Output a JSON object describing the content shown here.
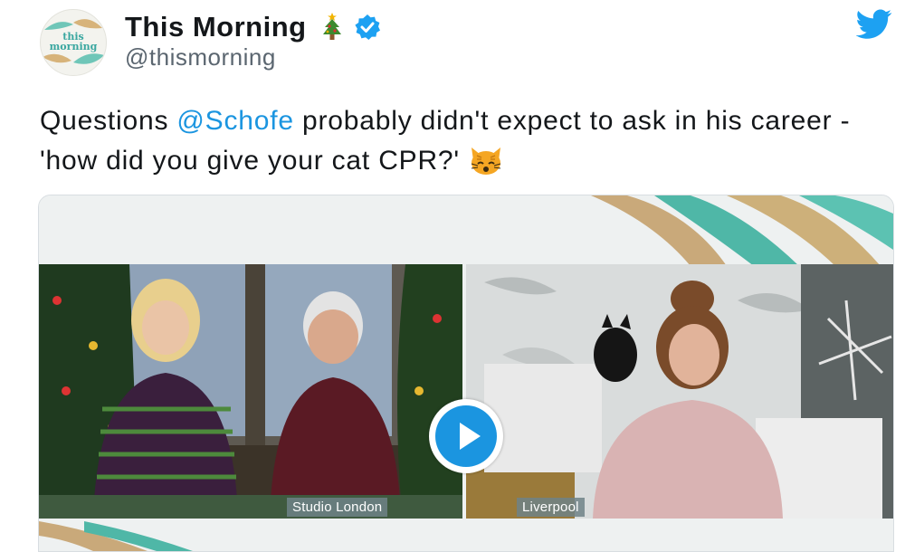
{
  "account": {
    "display_name": "This Morning",
    "handle": "@thismorning",
    "avatar_text": "this morning",
    "verified": true
  },
  "tweet": {
    "text_part1": "Questions ",
    "mention": "@Schofe",
    "text_part2": " probably didn't expect to ask in his career - 'how did you give your cat CPR?' "
  },
  "media": {
    "caption_left": "Studio London",
    "caption_right": "Liverpool"
  },
  "icons": {
    "tree": "christmas-tree-icon",
    "verified": "verified-badge-icon",
    "twitter": "twitter-bird-icon",
    "cat": "cat-face-emoji",
    "play": "play-icon"
  },
  "colors": {
    "mention": "#1b95e0",
    "verified": "#1da1f2",
    "play": "#1b95e0"
  }
}
